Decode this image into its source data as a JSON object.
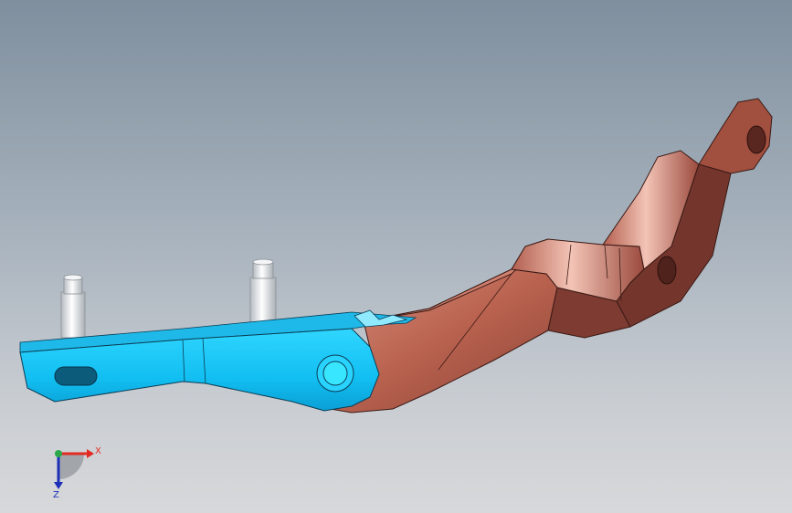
{
  "colors": {
    "blue_part": "#1fc8f5",
    "blue_part_dark": "#0fa6d8",
    "copper_part": "#c46e5e",
    "copper_dark": "#7a3a30",
    "copper_light": "#e6a694",
    "pin": "#e4e7ea",
    "background_top": "#7f8f9e",
    "background_bottom": "#d7d8da",
    "axis_x": "#e32b22",
    "axis_y": "#2aa84a",
    "axis_z": "#1d2fb8"
  },
  "triad": {
    "x_label": "X",
    "z_label": "Z"
  }
}
